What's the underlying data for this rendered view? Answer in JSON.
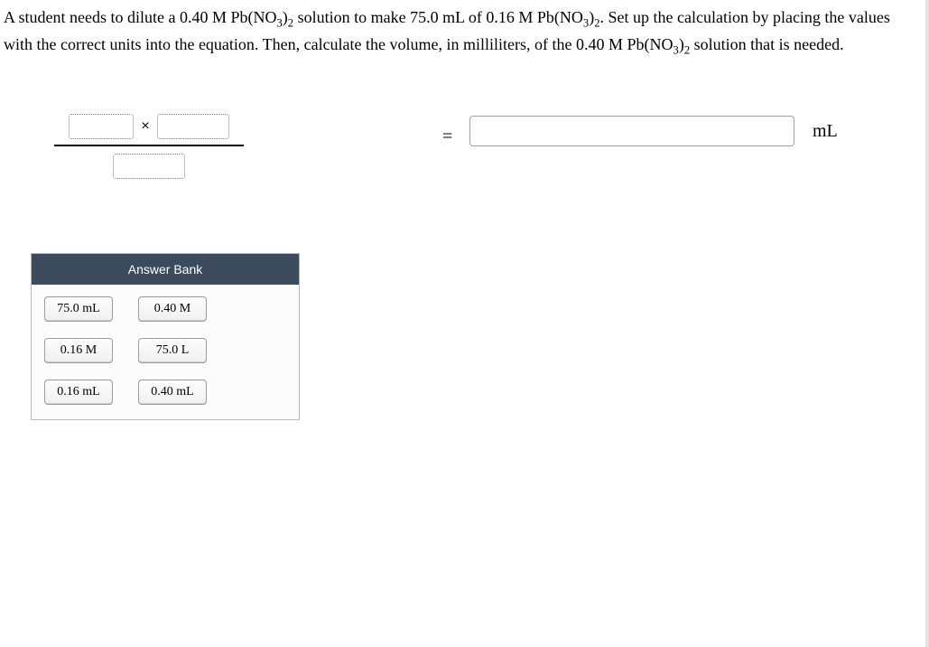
{
  "problem": {
    "line1_a": "A student needs to dilute a 0.40 M Pb(NO",
    "line1_b": ")",
    "line1_c": " solution to make 75.0 mL of 0.16 M Pb(NO",
    "line1_d": ")",
    "line1_e": ". Set up the calculation by placing the values with the correct units into the equation. Then, calculate the volume, in milliliters, of the 0.40 M Pb(NO",
    "line1_f": ")",
    "line1_g": " solution that is needed.",
    "sub3": "3",
    "sub2": "2"
  },
  "equation": {
    "times": "×",
    "equals": "=",
    "unit": "mL"
  },
  "answer_bank": {
    "title": "Answer Bank",
    "tiles": [
      "75.0 mL",
      "0.40 M",
      "0.16 M",
      "75.0 L",
      "0.16 mL",
      "0.40 mL"
    ]
  },
  "result_value": ""
}
